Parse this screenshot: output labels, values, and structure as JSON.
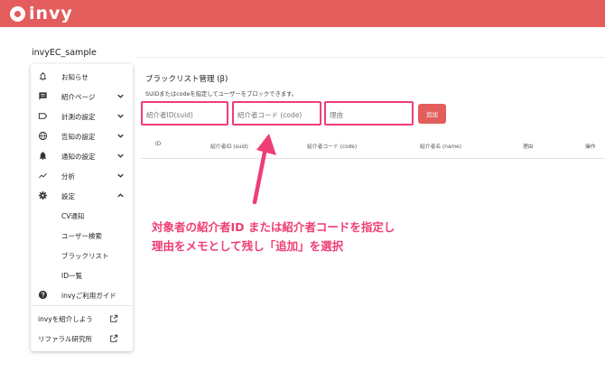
{
  "app": {
    "logo_text": "invy",
    "project_name": "invyEC_sample"
  },
  "sidebar": {
    "items": [
      {
        "label": "お知らせ",
        "icon": "bell-outline-icon"
      },
      {
        "label": "紹介ページ",
        "icon": "chat-bubble-icon"
      },
      {
        "label": "計測の設定",
        "icon": "label-tag-icon"
      },
      {
        "label": "告知の設定",
        "icon": "globe-icon"
      },
      {
        "label": "通知の設定",
        "icon": "bell-filled-icon"
      },
      {
        "label": "分析",
        "icon": "trending-line-icon"
      },
      {
        "label": "設定",
        "icon": "gear-icon"
      }
    ],
    "sub_items": [
      {
        "label": "CV通知"
      },
      {
        "label": "ユーザー検索"
      },
      {
        "label": "ブラックリスト"
      },
      {
        "label": "ID一覧"
      }
    ],
    "guide": {
      "label": "invyご利用ガイド",
      "icon": "help-circle-icon"
    },
    "links": [
      {
        "label": "invyを紹介しよう",
        "icon": "external-link-icon"
      },
      {
        "label": "リファラル研究所",
        "icon": "external-link-icon"
      }
    ]
  },
  "main": {
    "title": "ブラックリスト管理 (β)",
    "description": "SUIDまたはcodeを指定してユーザーをブロックできます。",
    "form": {
      "suid_placeholder": "紹介者ID(suid)",
      "code_placeholder": "紹介者コード (code)",
      "reason_placeholder": "理由",
      "add_label": "追加"
    },
    "table": {
      "headers": [
        "ID",
        "紹介者ID (suid)",
        "紹介者コード (code)",
        "紹介者名 (name)",
        "理由",
        "操作"
      ]
    }
  },
  "annotation": {
    "line1": "対象者の紹介者ID または紹介者コードを指定し",
    "line2": "理由をメモとして残し「追加」を選択"
  },
  "colors": {
    "brand": "#e35d5d",
    "highlight": "#ef3e74"
  }
}
